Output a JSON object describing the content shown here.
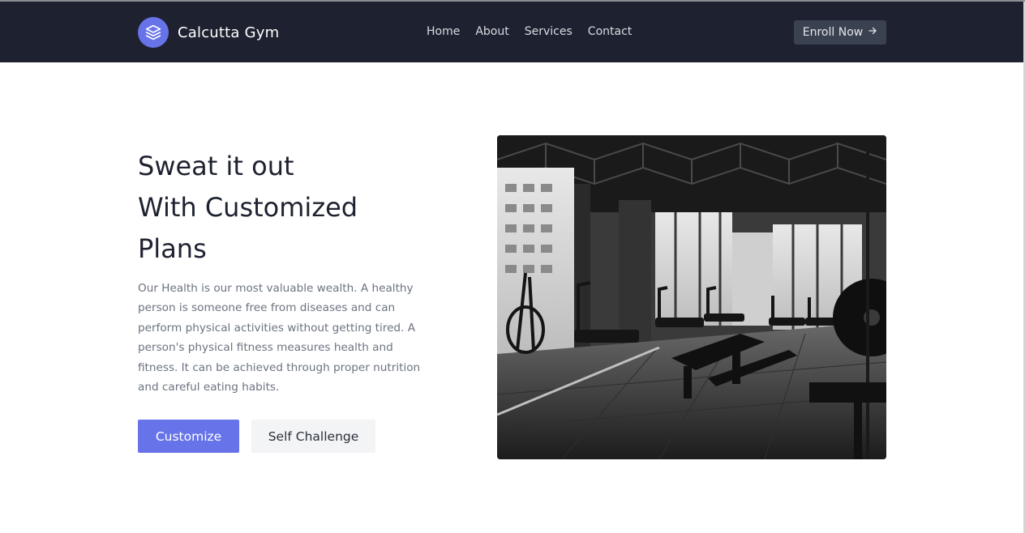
{
  "brand": {
    "name": "Calcutta Gym",
    "logo_icon": "stack-layers-icon",
    "logo_color": "#6773e8"
  },
  "nav": {
    "links": [
      "Home",
      "About",
      "Services",
      "Contact"
    ]
  },
  "header": {
    "cta_label": "Enroll Now",
    "cta_icon": "arrow-right-icon",
    "background": "#1e2230"
  },
  "hero": {
    "title_lines": [
      "Sweat it out",
      "With Customized",
      "Plans"
    ],
    "description": "Our Health is our most valuable wealth. A healthy person is someone free from diseases and can perform physical activities without getting tired. A person's physical fitness measures health and fitness. It can be achieved through proper nutrition and careful eating habits.",
    "primary_button": "Customize",
    "secondary_button": "Self Challenge",
    "accent": "#6773e8"
  }
}
